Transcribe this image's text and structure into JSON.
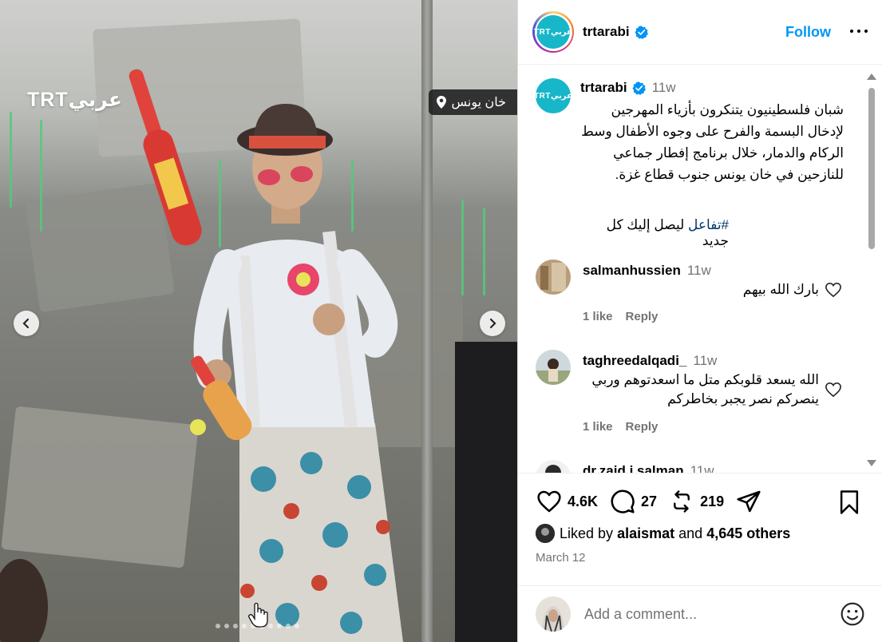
{
  "media": {
    "watermark": "TRTعربي",
    "location": "خان يونس",
    "slide_count": 10,
    "active_slide": 6
  },
  "header": {
    "username": "trtarabi",
    "logo_text": "TRTعربي",
    "follow_label": "Follow",
    "verified": true
  },
  "caption": {
    "username": "trtarabi",
    "time": "11w",
    "text": "شبان فلسطينيون يتنكرون بأزياء المهرجين لإدخال البسمة والفرح على وجوه الأطفال وسط الركام والدمار، خلال برنامج إفطار جماعي للنازحين في خان يونس جنوب قطاع غزة.",
    "tag_text": "ليصل إليك كل جديد",
    "tag": "#تفاعل"
  },
  "comments": [
    {
      "username": "salmanhussien",
      "time": "11w",
      "text": "بارك الله بيهم",
      "likes": "1 like",
      "reply": "Reply"
    },
    {
      "username": "taghreedalqadi_",
      "time": "11w",
      "text": "الله يسعد قلوبكم متل ما اسعدتوهم وربي ينصركم نصر يجبر بخاطركم",
      "likes": "1 like",
      "reply": "Reply"
    },
    {
      "username": "dr.zaid.j.salman",
      "time": "11w"
    }
  ],
  "actions": {
    "likes_count": "4.6K",
    "comments_count": "27",
    "reposts_count": "219"
  },
  "liked_by": {
    "prefix": "Liked by",
    "user": "alaismat",
    "conj": "and",
    "others": "4,645 others"
  },
  "date": "March 12",
  "add_comment": {
    "placeholder": "Add a comment..."
  },
  "colors": {
    "accent": "#0095f6",
    "hashtag": "#00376b",
    "muted": "#737373",
    "trt_logo": "#17b6c9"
  }
}
